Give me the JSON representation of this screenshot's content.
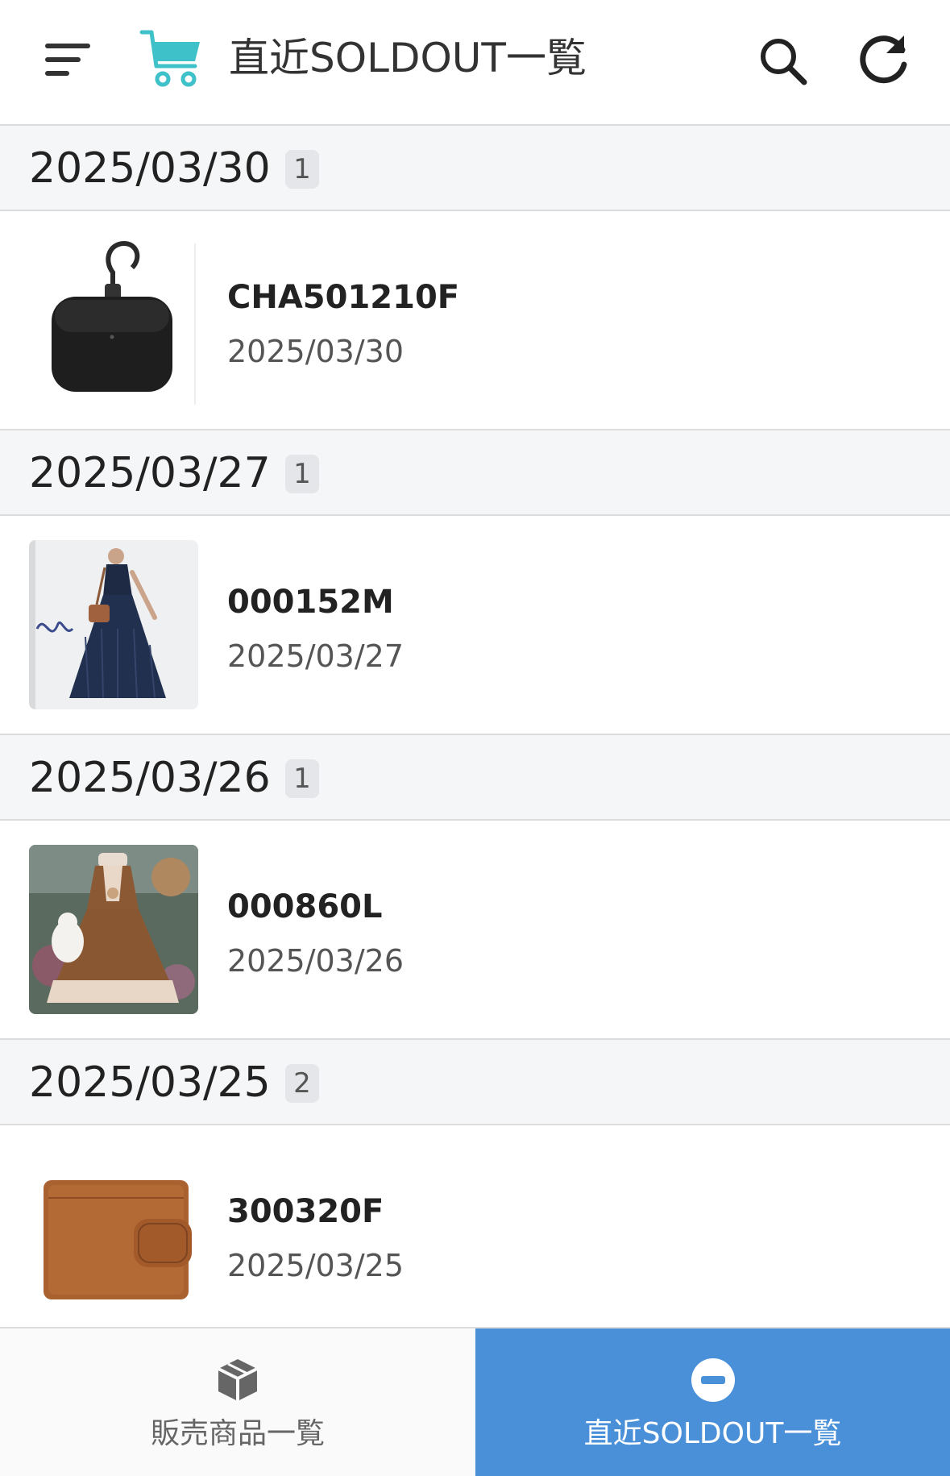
{
  "header": {
    "title": "直近SOLDOUT一覧",
    "icons": [
      "menu-icon",
      "cart-icon",
      "search-icon",
      "refresh-icon"
    ],
    "cart_color": "#3fc1c9"
  },
  "sections": [
    {
      "date": "2025/03/30",
      "count": "1",
      "items": [
        {
          "code": "CHA501210F",
          "date": "2025/03/30",
          "thumb": "black-earbuds-case"
        }
      ]
    },
    {
      "date": "2025/03/27",
      "count": "1",
      "items": [
        {
          "code": "000152M",
          "date": "2025/03/27",
          "thumb": "navy-pleated-dress"
        }
      ]
    },
    {
      "date": "2025/03/26",
      "count": "1",
      "items": [
        {
          "code": "000860L",
          "date": "2025/03/26",
          "thumb": "brown-frill-dress"
        }
      ]
    },
    {
      "date": "2025/03/25",
      "count": "2",
      "items": [
        {
          "code": "300320F",
          "date": "2025/03/25",
          "thumb": "brown-leather-wallet"
        }
      ]
    }
  ],
  "tabs": {
    "products": {
      "label": "販売商品一覧",
      "icon": "box-icon"
    },
    "soldout": {
      "label": "直近SOLDOUT一覧",
      "icon": "minus-circle-icon",
      "active": true
    }
  },
  "colors": {
    "accent": "#4a90d9",
    "section_bg": "#f5f6f7"
  }
}
